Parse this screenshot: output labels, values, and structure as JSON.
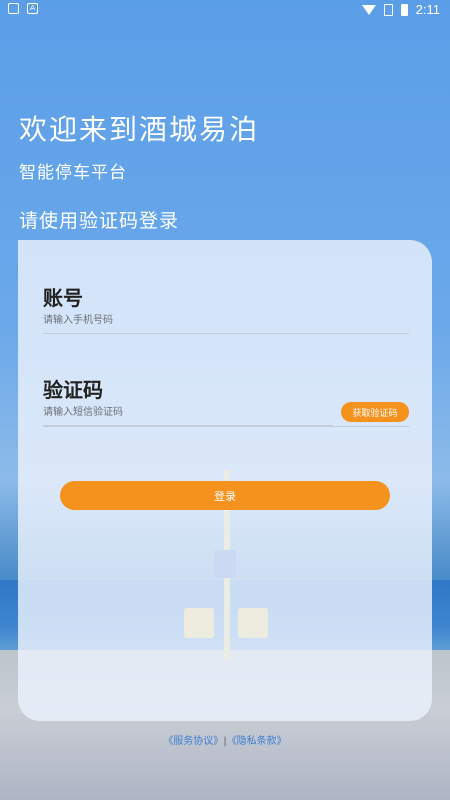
{
  "status_bar": {
    "left_icons": [
      "keyboard-icon",
      "a-icon"
    ],
    "left_a_glyph": "A",
    "time": "2:11",
    "right_icons": [
      "wifi-icon",
      "no-sim-icon",
      "battery-charging-icon"
    ]
  },
  "header": {
    "title": "欢迎来到酒城易泊",
    "subtitle": "智能停车平台",
    "login_mode": "请使用验证码登录"
  },
  "form": {
    "account_label": "账号",
    "account_placeholder": "请输入手机号码",
    "account_value": "",
    "code_label": "验证码",
    "code_placeholder": "请输入短信验证码",
    "code_value": "",
    "get_code_label": "获取验证码",
    "login_label": "登录"
  },
  "footer": {
    "service_agreement": "《服务协议》",
    "separator": "|",
    "privacy_terms": "《隐私条款》"
  },
  "colors": {
    "accent": "#f5921e",
    "link": "#3c7fd0",
    "background_top": "#5b9ee8"
  }
}
